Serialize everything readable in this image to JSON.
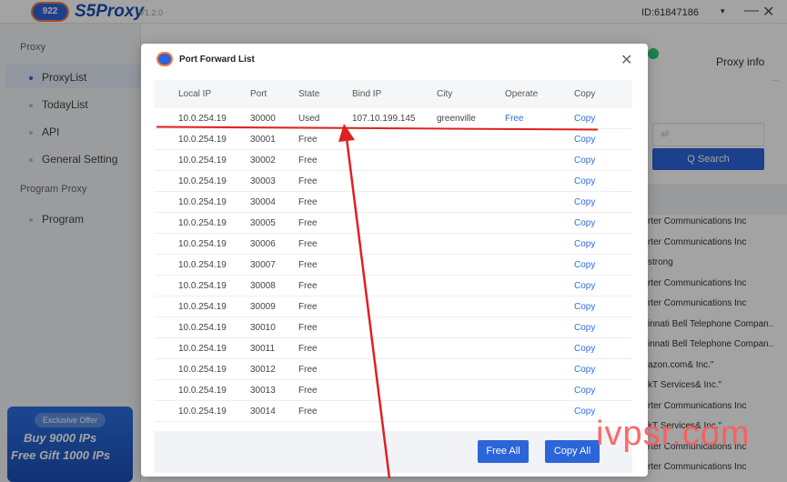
{
  "app": {
    "logo_badge": "922",
    "name": "S5Proxy",
    "version": "V1.2.0",
    "user_id": "ID:61847186",
    "user_caret": "▾",
    "min_glyph": "—",
    "close_glyph": "✕"
  },
  "sidebar": {
    "groups": [
      "Proxy",
      "Program Proxy"
    ],
    "items": [
      {
        "label": "ProxyList"
      },
      {
        "label": "TodayList"
      },
      {
        "label": "API"
      },
      {
        "label": "General Setting"
      },
      {
        "label": "Program"
      }
    ]
  },
  "offer": {
    "tag": "Exclusive Offer",
    "line1": "Buy 9000 IPs",
    "line2": "Free Gift 1000 IPs"
  },
  "right_panel": {
    "title": "Proxy info",
    "more": "...",
    "search_placeholder": "all",
    "search_label": "Q  Search",
    "isp_rows": [
      "rter Communications Inc",
      "rter Communications Inc",
      "strong",
      "rter Communications Inc",
      "rter Communications Inc",
      "innati Bell Telephone Compan..",
      "innati Bell Telephone Compan..",
      "azon.com& Inc.\"",
      "kT Services& Inc.\"",
      "rter Communications Inc",
      "kT Services& Inc.\"",
      "rter Communications Inc",
      "rter Communications Inc"
    ]
  },
  "modal": {
    "title": "Port Forward List",
    "close_glyph": "✕",
    "columns": [
      "Local IP",
      "Port",
      "State",
      "Bind IP",
      "City",
      "Operate",
      "Copy"
    ],
    "rows": [
      {
        "local_ip": "10.0.254.19",
        "port": "30000",
        "state": "Used",
        "bind_ip": "107.10.199.145",
        "city": "greenville",
        "operate": "Free",
        "copy": "Copy"
      },
      {
        "local_ip": "10.0.254.19",
        "port": "30001",
        "state": "Free",
        "bind_ip": "",
        "city": "",
        "operate": "",
        "copy": "Copy"
      },
      {
        "local_ip": "10.0.254.19",
        "port": "30002",
        "state": "Free",
        "bind_ip": "",
        "city": "",
        "operate": "",
        "copy": "Copy"
      },
      {
        "local_ip": "10.0.254.19",
        "port": "30003",
        "state": "Free",
        "bind_ip": "",
        "city": "",
        "operate": "",
        "copy": "Copy"
      },
      {
        "local_ip": "10.0.254.19",
        "port": "30004",
        "state": "Free",
        "bind_ip": "",
        "city": "",
        "operate": "",
        "copy": "Copy"
      },
      {
        "local_ip": "10.0.254.19",
        "port": "30005",
        "state": "Free",
        "bind_ip": "",
        "city": "",
        "operate": "",
        "copy": "Copy"
      },
      {
        "local_ip": "10.0.254.19",
        "port": "30006",
        "state": "Free",
        "bind_ip": "",
        "city": "",
        "operate": "",
        "copy": "Copy"
      },
      {
        "local_ip": "10.0.254.19",
        "port": "30007",
        "state": "Free",
        "bind_ip": "",
        "city": "",
        "operate": "",
        "copy": "Copy"
      },
      {
        "local_ip": "10.0.254.19",
        "port": "30008",
        "state": "Free",
        "bind_ip": "",
        "city": "",
        "operate": "",
        "copy": "Copy"
      },
      {
        "local_ip": "10.0.254.19",
        "port": "30009",
        "state": "Free",
        "bind_ip": "",
        "city": "",
        "operate": "",
        "copy": "Copy"
      },
      {
        "local_ip": "10.0.254.19",
        "port": "30010",
        "state": "Free",
        "bind_ip": "",
        "city": "",
        "operate": "",
        "copy": "Copy"
      },
      {
        "local_ip": "10.0.254.19",
        "port": "30011",
        "state": "Free",
        "bind_ip": "",
        "city": "",
        "operate": "",
        "copy": "Copy"
      },
      {
        "local_ip": "10.0.254.19",
        "port": "30012",
        "state": "Free",
        "bind_ip": "",
        "city": "",
        "operate": "",
        "copy": "Copy"
      },
      {
        "local_ip": "10.0.254.19",
        "port": "30013",
        "state": "Free",
        "bind_ip": "",
        "city": "",
        "operate": "",
        "copy": "Copy"
      },
      {
        "local_ip": "10.0.254.19",
        "port": "30014",
        "state": "Free",
        "bind_ip": "",
        "city": "",
        "operate": "",
        "copy": "Copy"
      }
    ],
    "free_all": "Free All",
    "copy_all": "Copy All"
  },
  "watermark": "ivpsr.com",
  "colors": {
    "accent": "#2c65d9",
    "link": "#2f6ee0",
    "annotation": "#e02020"
  }
}
